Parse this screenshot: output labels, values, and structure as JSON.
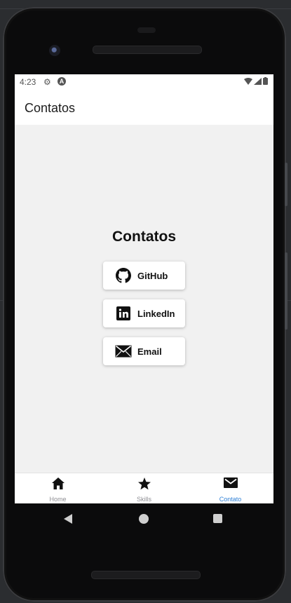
{
  "status_bar": {
    "time": "4:23"
  },
  "app_bar": {
    "title": "Contatos"
  },
  "main": {
    "heading": "Contatos",
    "buttons": [
      {
        "label": "GitHub",
        "icon": "github-icon"
      },
      {
        "label": "LinkedIn",
        "icon": "linkedin-icon"
      },
      {
        "label": "Email",
        "icon": "mail-icon"
      }
    ]
  },
  "bottom_nav": {
    "active_color": "#2f80d6",
    "tabs": [
      {
        "label": "Home",
        "icon": "home-icon"
      },
      {
        "label": "Skills",
        "icon": "star-icon"
      },
      {
        "label": "Contato",
        "icon": "mail-icon",
        "active": true
      }
    ]
  }
}
